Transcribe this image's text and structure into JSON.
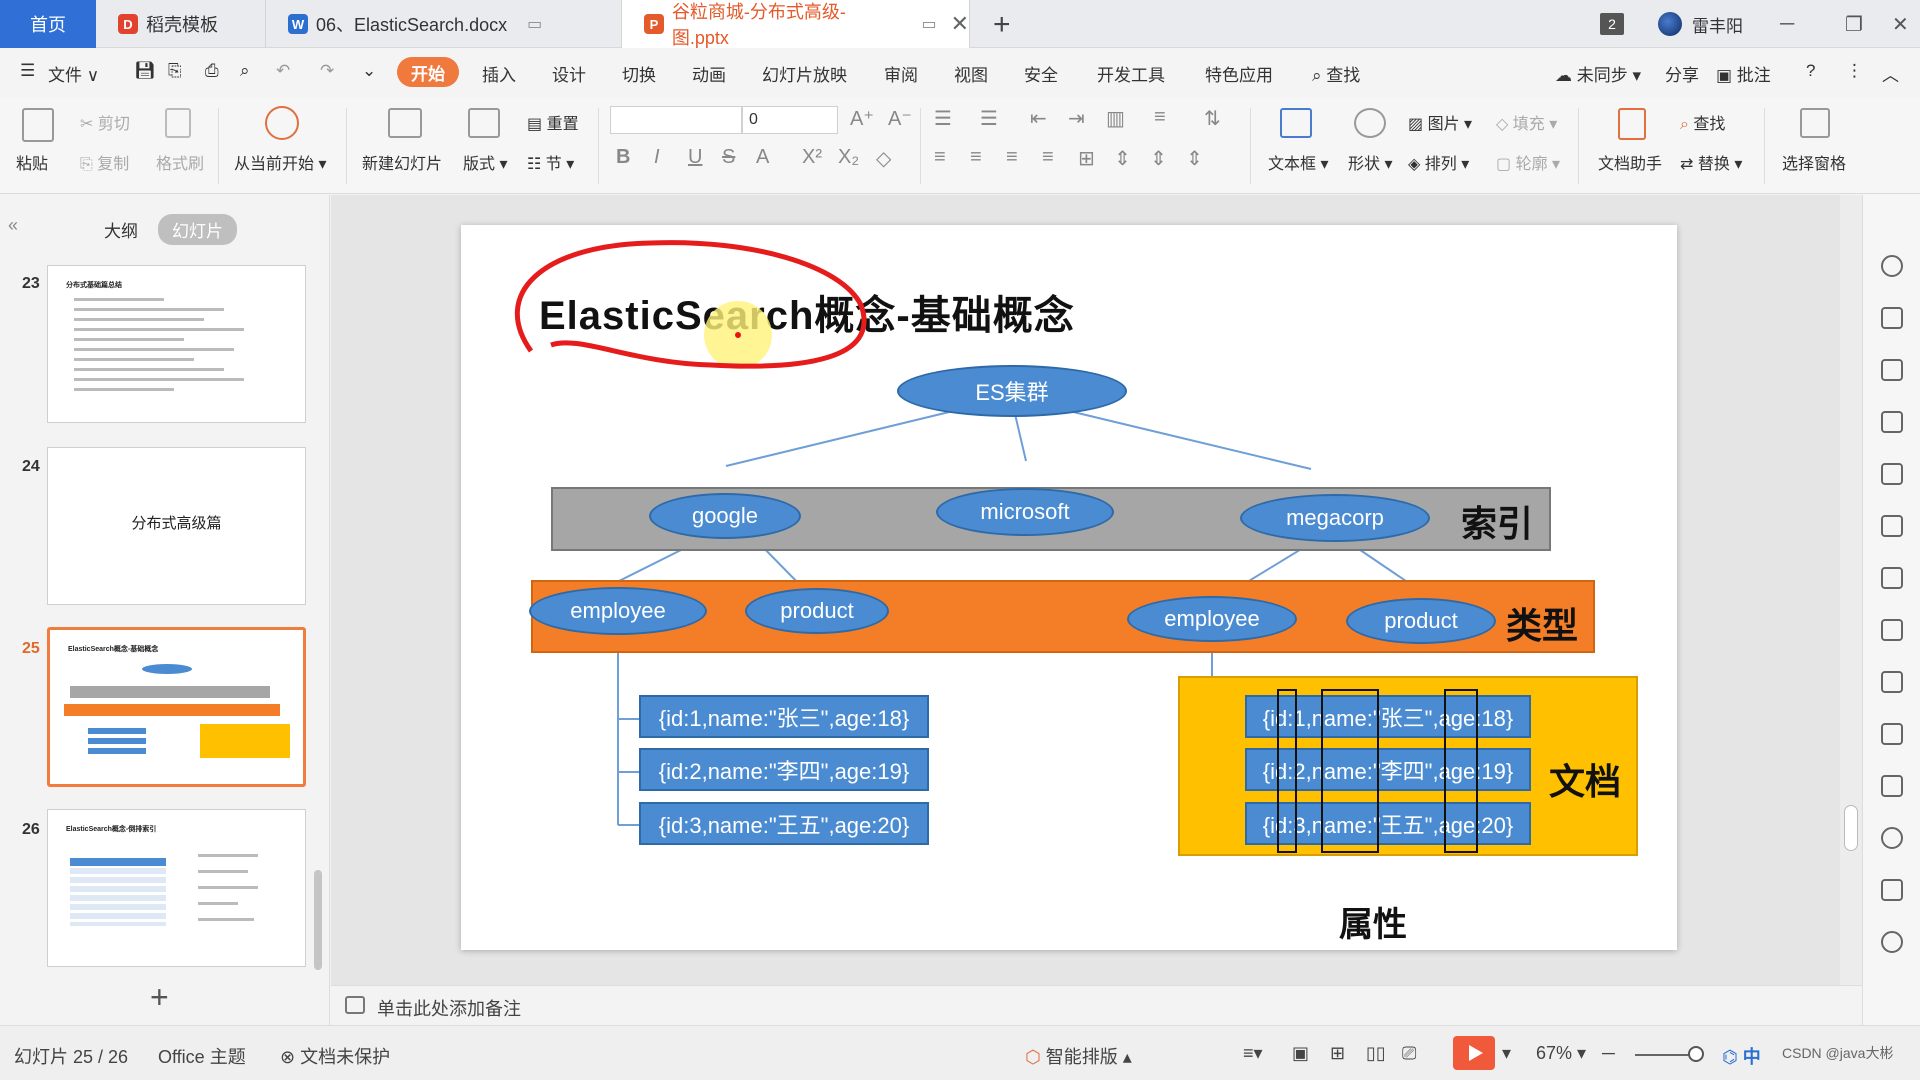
{
  "tabs": {
    "home": "首页",
    "template": "稻壳模板",
    "docx": "06、ElasticSearch.docx",
    "pptx": "谷粒商城-分布式高级-图.pptx",
    "window_count": "2",
    "user": "雷丰阳"
  },
  "menu": {
    "file": "文件",
    "start": "开始",
    "insert": "插入",
    "design": "设计",
    "transition": "切换",
    "animation": "动画",
    "slideshow": "幻灯片放映",
    "review": "审阅",
    "view": "视图",
    "security": "安全",
    "devtools": "开发工具",
    "features": "特色应用",
    "search": "查找",
    "unsync": "未同步",
    "share": "分享",
    "comment": "批注"
  },
  "ribbon": {
    "paste": "粘贴",
    "cut": "剪切",
    "copy": "复制",
    "format_painter": "格式刷",
    "from_current": "从当前开始",
    "new_slide": "新建幻灯片",
    "layout": "版式",
    "reset": "重置",
    "section": "节",
    "font_size": "0",
    "textbox": "文本框",
    "shape": "形状",
    "picture": "图片",
    "arrange": "排列",
    "fill": "填充",
    "outline": "轮廓",
    "doc_assistant": "文档助手",
    "find": "查找",
    "replace": "替换",
    "select_pane": "选择窗格"
  },
  "left_panel": {
    "outline_tab": "大纲",
    "slides_tab": "幻灯片",
    "thumbs": [
      {
        "num": "23",
        "title": "分布式基础篇总结"
      },
      {
        "num": "24",
        "center": "分布式高级篇"
      },
      {
        "num": "25",
        "title": "ElasticSearch概念-基础概念"
      },
      {
        "num": "26",
        "title": "ElasticSearch概念-倒排索引"
      }
    ]
  },
  "slide": {
    "title": "ElasticSearch概念-基础概念",
    "cluster": "ES集群",
    "indices": [
      "google",
      "microsoft",
      "megacorp"
    ],
    "index_label": "索引",
    "types_left": [
      "employee",
      "product"
    ],
    "types_right": [
      "employee",
      "product"
    ],
    "type_label": "类型",
    "docs": [
      "{id:1,name:\"张三\",age:18}",
      "{id:2,name:\"李四\",age:19}",
      "{id:3,name:\"王五\",age:20}"
    ],
    "doc_label": "文档",
    "prop_label": "属性"
  },
  "notes": {
    "placeholder": "单击此处添加备注"
  },
  "status": {
    "slide_pos": "幻灯片 25 / 26",
    "theme": "Office 主题",
    "protect": "文档未保护",
    "smart_layout": "智能排版",
    "zoom": "67%",
    "ime": "中",
    "watermark": "CSDN @java大彬"
  },
  "colors": {
    "accent": "#f0793e",
    "gray_band": "#a6a6a6",
    "orange_band": "#f47e27",
    "yellow_box": "#ffc000",
    "ellipse": "#4a8bd1"
  }
}
